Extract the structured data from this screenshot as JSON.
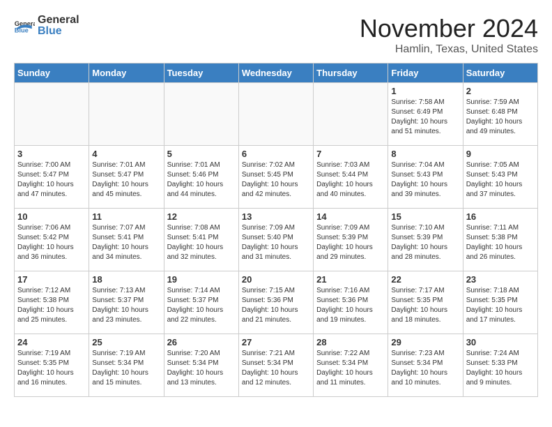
{
  "logo": {
    "text_general": "General",
    "text_blue": "Blue"
  },
  "header": {
    "month": "November 2024",
    "location": "Hamlin, Texas, United States"
  },
  "weekdays": [
    "Sunday",
    "Monday",
    "Tuesday",
    "Wednesday",
    "Thursday",
    "Friday",
    "Saturday"
  ],
  "weeks": [
    [
      {
        "day": "",
        "info": ""
      },
      {
        "day": "",
        "info": ""
      },
      {
        "day": "",
        "info": ""
      },
      {
        "day": "",
        "info": ""
      },
      {
        "day": "",
        "info": ""
      },
      {
        "day": "1",
        "info": "Sunrise: 7:58 AM\nSunset: 6:49 PM\nDaylight: 10 hours and 51 minutes."
      },
      {
        "day": "2",
        "info": "Sunrise: 7:59 AM\nSunset: 6:48 PM\nDaylight: 10 hours and 49 minutes."
      }
    ],
    [
      {
        "day": "3",
        "info": "Sunrise: 7:00 AM\nSunset: 5:47 PM\nDaylight: 10 hours and 47 minutes."
      },
      {
        "day": "4",
        "info": "Sunrise: 7:01 AM\nSunset: 5:47 PM\nDaylight: 10 hours and 45 minutes."
      },
      {
        "day": "5",
        "info": "Sunrise: 7:01 AM\nSunset: 5:46 PM\nDaylight: 10 hours and 44 minutes."
      },
      {
        "day": "6",
        "info": "Sunrise: 7:02 AM\nSunset: 5:45 PM\nDaylight: 10 hours and 42 minutes."
      },
      {
        "day": "7",
        "info": "Sunrise: 7:03 AM\nSunset: 5:44 PM\nDaylight: 10 hours and 40 minutes."
      },
      {
        "day": "8",
        "info": "Sunrise: 7:04 AM\nSunset: 5:43 PM\nDaylight: 10 hours and 39 minutes."
      },
      {
        "day": "9",
        "info": "Sunrise: 7:05 AM\nSunset: 5:43 PM\nDaylight: 10 hours and 37 minutes."
      }
    ],
    [
      {
        "day": "10",
        "info": "Sunrise: 7:06 AM\nSunset: 5:42 PM\nDaylight: 10 hours and 36 minutes."
      },
      {
        "day": "11",
        "info": "Sunrise: 7:07 AM\nSunset: 5:41 PM\nDaylight: 10 hours and 34 minutes."
      },
      {
        "day": "12",
        "info": "Sunrise: 7:08 AM\nSunset: 5:41 PM\nDaylight: 10 hours and 32 minutes."
      },
      {
        "day": "13",
        "info": "Sunrise: 7:09 AM\nSunset: 5:40 PM\nDaylight: 10 hours and 31 minutes."
      },
      {
        "day": "14",
        "info": "Sunrise: 7:09 AM\nSunset: 5:39 PM\nDaylight: 10 hours and 29 minutes."
      },
      {
        "day": "15",
        "info": "Sunrise: 7:10 AM\nSunset: 5:39 PM\nDaylight: 10 hours and 28 minutes."
      },
      {
        "day": "16",
        "info": "Sunrise: 7:11 AM\nSunset: 5:38 PM\nDaylight: 10 hours and 26 minutes."
      }
    ],
    [
      {
        "day": "17",
        "info": "Sunrise: 7:12 AM\nSunset: 5:38 PM\nDaylight: 10 hours and 25 minutes."
      },
      {
        "day": "18",
        "info": "Sunrise: 7:13 AM\nSunset: 5:37 PM\nDaylight: 10 hours and 23 minutes."
      },
      {
        "day": "19",
        "info": "Sunrise: 7:14 AM\nSunset: 5:37 PM\nDaylight: 10 hours and 22 minutes."
      },
      {
        "day": "20",
        "info": "Sunrise: 7:15 AM\nSunset: 5:36 PM\nDaylight: 10 hours and 21 minutes."
      },
      {
        "day": "21",
        "info": "Sunrise: 7:16 AM\nSunset: 5:36 PM\nDaylight: 10 hours and 19 minutes."
      },
      {
        "day": "22",
        "info": "Sunrise: 7:17 AM\nSunset: 5:35 PM\nDaylight: 10 hours and 18 minutes."
      },
      {
        "day": "23",
        "info": "Sunrise: 7:18 AM\nSunset: 5:35 PM\nDaylight: 10 hours and 17 minutes."
      }
    ],
    [
      {
        "day": "24",
        "info": "Sunrise: 7:19 AM\nSunset: 5:35 PM\nDaylight: 10 hours and 16 minutes."
      },
      {
        "day": "25",
        "info": "Sunrise: 7:19 AM\nSunset: 5:34 PM\nDaylight: 10 hours and 15 minutes."
      },
      {
        "day": "26",
        "info": "Sunrise: 7:20 AM\nSunset: 5:34 PM\nDaylight: 10 hours and 13 minutes."
      },
      {
        "day": "27",
        "info": "Sunrise: 7:21 AM\nSunset: 5:34 PM\nDaylight: 10 hours and 12 minutes."
      },
      {
        "day": "28",
        "info": "Sunrise: 7:22 AM\nSunset: 5:34 PM\nDaylight: 10 hours and 11 minutes."
      },
      {
        "day": "29",
        "info": "Sunrise: 7:23 AM\nSunset: 5:34 PM\nDaylight: 10 hours and 10 minutes."
      },
      {
        "day": "30",
        "info": "Sunrise: 7:24 AM\nSunset: 5:33 PM\nDaylight: 10 hours and 9 minutes."
      }
    ]
  ]
}
